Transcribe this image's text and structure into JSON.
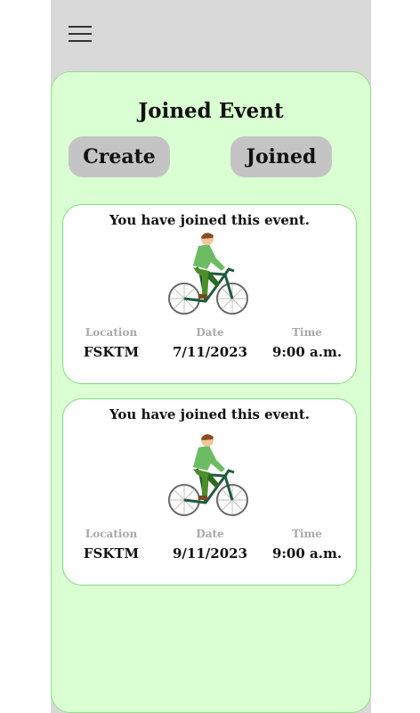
{
  "header": {
    "menu_icon": "hamburger-menu-icon"
  },
  "page": {
    "title": "Joined Event"
  },
  "tabs": {
    "create_label": "Create",
    "joined_label": "Joined"
  },
  "labels": {
    "location": "Location",
    "date": "Date",
    "time": "Time"
  },
  "events": [
    {
      "message": "You have joined this event.",
      "location": "FSKTM",
      "date": "7/11/2023",
      "time": "9:00 a.m."
    },
    {
      "message": "You have joined this event.",
      "location": "FSKTM",
      "date": "9/11/2023",
      "time": "9:00 a.m."
    }
  ],
  "colors": {
    "panel": "#daffd2",
    "panel_border": "#8fe08a",
    "pill": "#c4c4c4",
    "header": "#d9d9d9"
  }
}
